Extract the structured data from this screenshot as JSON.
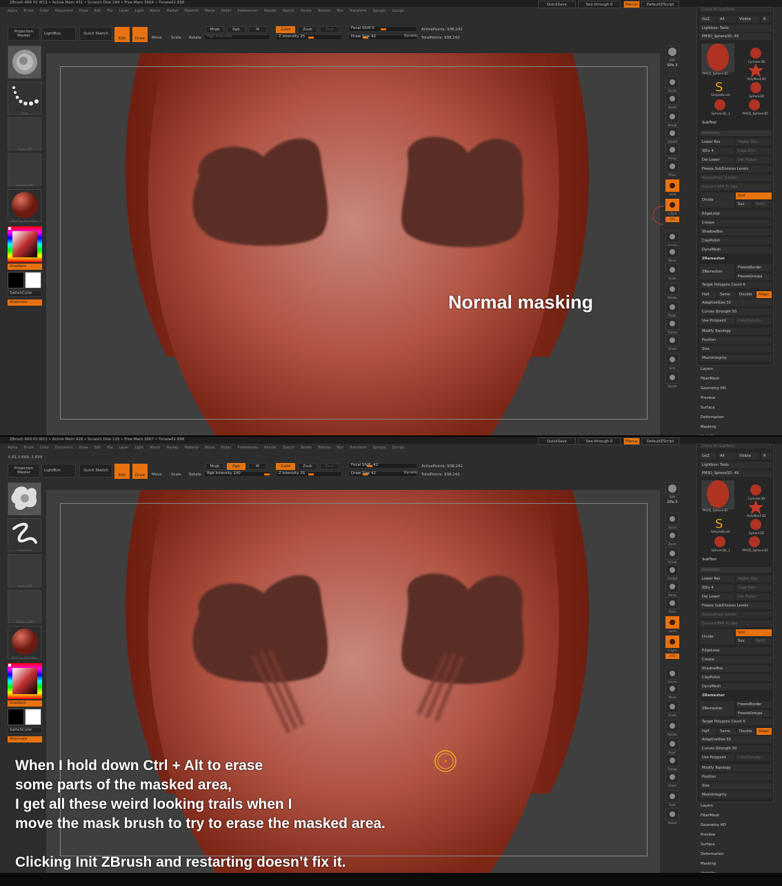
{
  "panels": [
    {
      "title": "ZBrush 4R6 P2    W11   • Active Mem 431 • Scratch Disk 184 • Free Mem 3664 • Timer▸61.898",
      "coords": "",
      "brush1": "Standard",
      "brush2": "Dots",
      "rgb_intensity": "Rgb Intensity",
      "focal_shift": "Focal Shift 0",
      "caption": "Normal masking",
      "rgb_active": false
    },
    {
      "title": "ZBrush 4R6 P2    W11   • Active Mem 428 • Scratch Disk 125 • Free Mem 3667 • Timer▸61.898",
      "coords": "0.61,0.689,-1.834",
      "brush1": "MaskPen",
      "brush2": "FreeHand",
      "rgb_intensity": "Rgb Intensity 100",
      "focal_shift": "Focal Shift -42",
      "caption_lines": [
        "When I hold down Ctrl + Alt to erase",
        "some parts of the masked area,",
        "I get all these weird looking trails when I",
        "move the mask brush to try to erase the masked area.",
        "",
        "Clicking Init ZBrush and restarting doesn’t fix it."
      ],
      "rgb_active": true
    }
  ],
  "menu": [
    "Alpha",
    "Brush",
    "Color",
    "Document",
    "Draw",
    "Edit",
    "File",
    "Layer",
    "Light",
    "Macro",
    "Marker",
    "Material",
    "Movie",
    "Picker",
    "Preferences",
    "Render",
    "Stencil",
    "Stroke",
    "Texture",
    "Tool",
    "Transform",
    "Zplugin",
    "Zscript"
  ],
  "top_right": {
    "quicksave": "QuickSave",
    "seethrough": "See-through  0",
    "menus": "Menus",
    "script": "DefaultZScript"
  },
  "toolbar": {
    "projection_master": "Projection Master",
    "lightbox": "LightBox",
    "quick_sketch": "Quick Sketch",
    "edit": "Edit",
    "draw": "Draw",
    "move": "Move",
    "scale": "Scale",
    "rotate": "Rotate",
    "mrgb": "Mrgb",
    "rgb": "Rgb",
    "m": "M",
    "zadd": "Zadd",
    "zsub": "Zsub",
    "zcut": "Zcut",
    "z_intensity": "Z Intensity 25",
    "draw_size": "Draw Size 42",
    "dynamic": "Dynamic",
    "active_points": "ActivePoints: 938,242",
    "total_points": "TotalPoints: 938,242"
  },
  "left_shelf": {
    "alpha": "Alpha Off",
    "texture": "Texture Off",
    "material": "MatCap Red Wax",
    "gradient": "Gradient",
    "switch_color": "SwitchColor",
    "alternate": "Alternate"
  },
  "right_icons": [
    "BPR",
    "SPix 3",
    "Scroll",
    "Zoom",
    "Actual",
    "AAHalf",
    "Persp",
    "Floor",
    "Local",
    "L.Sym",
    "XYZ",
    "Frame",
    "Move",
    "Scale",
    "Rotate",
    "PolyF",
    "Transp",
    "Ghost",
    "Solo",
    "Xpose"
  ],
  "tray": {
    "clone_all": "Clone All SubTools",
    "goz": "GoZ",
    "all": "All",
    "visible": "Visible",
    "r": "R",
    "lightbox_tools": "Lightbox› Tools",
    "current_tool": "PM3D_Sphere3D. 49",
    "tools": [
      "PM3D_Sphere3D",
      "Cylinder3D",
      "PolyMesh3D",
      "SimpleBrush",
      "Sphere3D",
      "Sphere3D_1",
      "PM3D_Sphere3D"
    ],
    "subtool": "SubTool",
    "geometry": "Geometry",
    "rows": [
      {
        "a": "Lower Res",
        "b": "Higher Res"
      },
      {
        "a": "SDiv 4",
        "b": "Cage  Rstr"
      },
      {
        "a": "Del Lower",
        "b": "Del Higher"
      }
    ],
    "freeze": "Freeze SubDivision Levels",
    "reconstruct": "Reconstruct Subdiv",
    "convert_bpr": "Convert BPR To Geo",
    "divide": "Divide",
    "smt": "Smt",
    "suv": "Suv",
    "reuv": "ReUV",
    "items": [
      "EdgeLoop",
      "Crease",
      "ShadowBox",
      "ClayPolish",
      "DynaMesh",
      "ZRemesher"
    ],
    "zremesher": "ZRemesher",
    "freeze_border": "FreezeBorder",
    "freeze_groups": "FreezeGroups",
    "target_polygons": "Target Polygons Count 6",
    "half": "Half",
    "same": "Same",
    "double": "Double",
    "adapt": "Adapt",
    "adaptive_size": "AdaptiveSize 50",
    "curves_strength": "Curves Strength 50",
    "use_polypaint": "Use Polypaint",
    "color_density": "ColorDensity",
    "modify_topology": "Modify Topology",
    "position": "Position",
    "size": "Size",
    "mesh_integrity": "MeshIntegrity",
    "sections": [
      "Layers",
      "FiberMesh",
      "Geometry HD",
      "Preview",
      "Surface",
      "Deformation",
      "Masking",
      "Visibility"
    ]
  },
  "colors": {
    "accent": "#e8720f",
    "mesh": "#b85a4a",
    "mask": "#5a2e28"
  }
}
